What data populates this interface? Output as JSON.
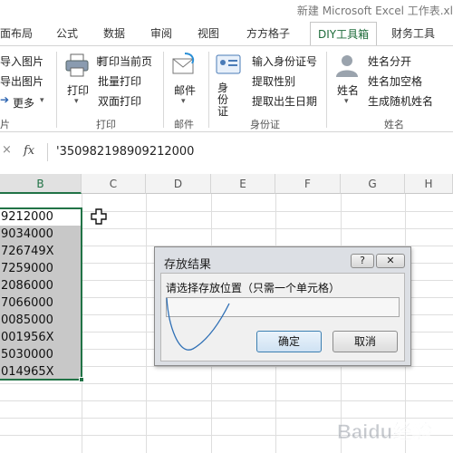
{
  "window": {
    "title": "新建 Microsoft Excel 工作表.xl"
  },
  "ribbon_tabs": [
    "面布局",
    "公式",
    "数据",
    "审阅",
    "视图",
    "方方格子",
    "DIY工具箱",
    "财务工具"
  ],
  "ribbon": {
    "pictures": {
      "import_label": "导入图片",
      "export_label": "导出图片",
      "more_label": "更多",
      "group_label": "片"
    },
    "print": {
      "print_label": "打印",
      "current_page_label": "打印当前页",
      "batch_label": "批量打印",
      "duplex_label": "双面打印",
      "group_label": "打印"
    },
    "mail": {
      "mail_label": "邮件",
      "group_label": "邮件"
    },
    "id_card": {
      "id_label": "身份证",
      "input_label": "输入身份证号",
      "gender_label": "提取性别",
      "birthday_label": "提取出生日期",
      "group_label": "身份证"
    },
    "name": {
      "name_label": "姓名",
      "split_label": "姓名分开",
      "add_space_label": "姓名加空格",
      "random_label": "生成随机姓名",
      "group_label": "姓名"
    }
  },
  "formula_bar": {
    "x_symbol": "×",
    "fx_symbol": "fx",
    "value": "'350982198909212000"
  },
  "sheet": {
    "column_headers": [
      "B",
      "C",
      "D",
      "E",
      "F",
      "G",
      "H"
    ],
    "cells": [
      "9212000",
      "9034000",
      "726749X",
      "7259000",
      "2086000",
      "7066000",
      "0085000",
      "001956X",
      "5030000",
      "014965X"
    ]
  },
  "dialog": {
    "title": "存放结果",
    "help_label": "?",
    "close_label": "✕",
    "prompt": "请选择存放位置（只需一个单元格）",
    "input_value": "",
    "ok_label": "确定",
    "cancel_label": "取消"
  },
  "watermark": {
    "text": "Baidu经验"
  },
  "colors": {
    "excel_green": "#217346",
    "selection_gray": "#c8c8c8",
    "dialog_bg": "#dcdfe4"
  }
}
